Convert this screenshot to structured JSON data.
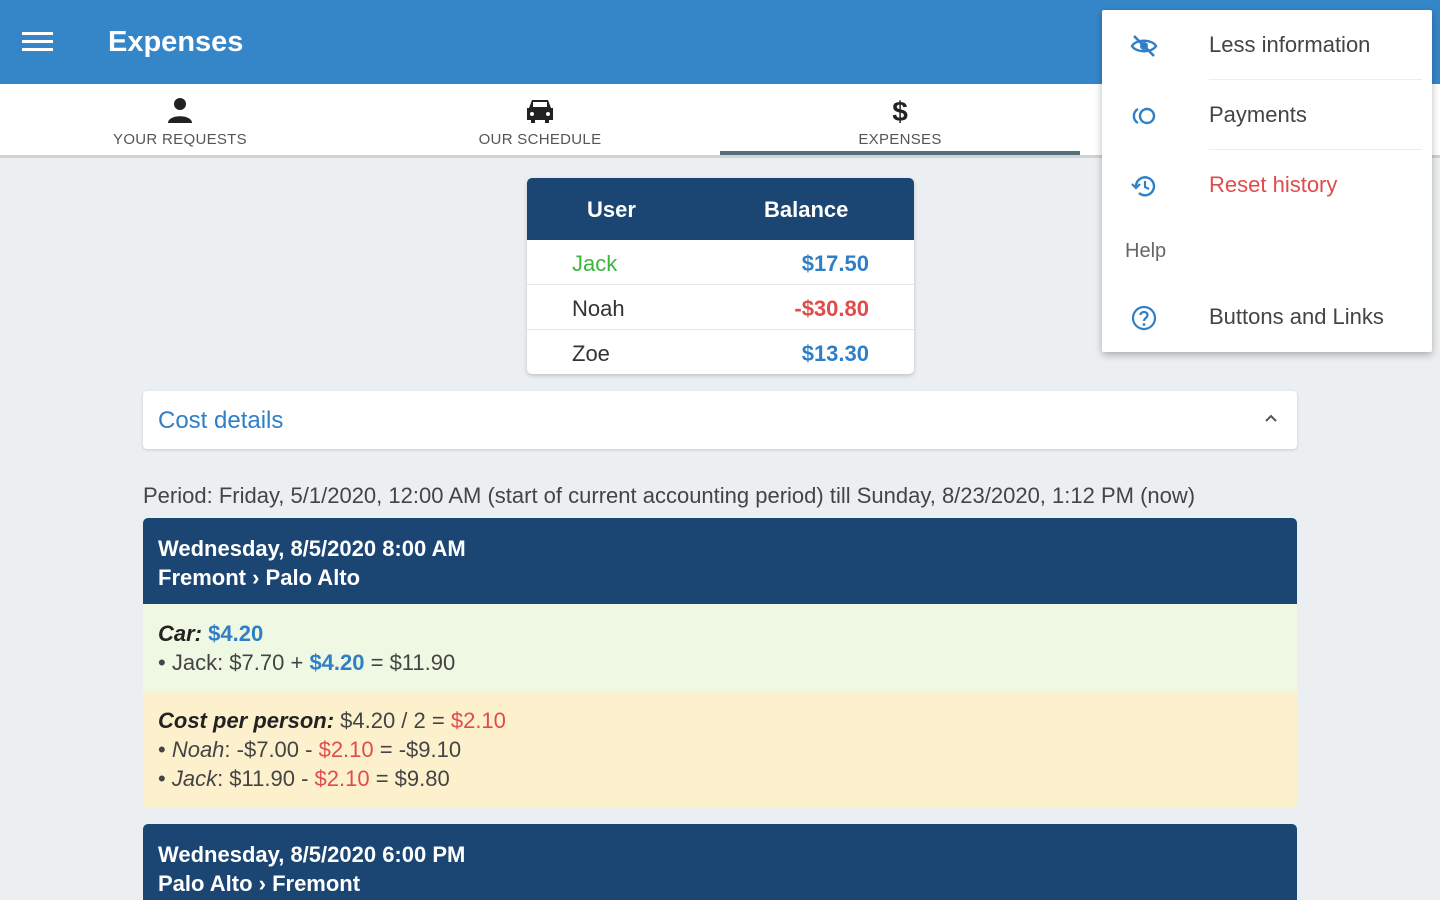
{
  "appbar": {
    "title": "Expenses"
  },
  "tabs": [
    {
      "label": "YOUR REQUESTS",
      "icon": "person-icon"
    },
    {
      "label": "OUR SCHEDULE",
      "icon": "car-icon"
    },
    {
      "label": "EXPENSES",
      "icon": "dollar-icon",
      "active": true
    },
    {
      "label": "",
      "icon": ""
    }
  ],
  "balance": {
    "headers": {
      "user": "User",
      "balance": "Balance"
    },
    "rows": [
      {
        "name": "Jack",
        "amount": "$17.50"
      },
      {
        "name": "Noah",
        "amount": "-$30.80"
      },
      {
        "name": "Zoe",
        "amount": "$13.30"
      }
    ]
  },
  "cost_details": {
    "title": "Cost details"
  },
  "period": "Period: Friday, 5/1/2020, 12:00 AM (start of current accounting period) till Sunday, 8/23/2020, 1:12 PM (now)",
  "trips": [
    {
      "date": "Wednesday, 8/5/2020 8:00 AM",
      "route": "Fremont › Palo Alto",
      "car": {
        "label": "Car:",
        "amount": "$4.20",
        "line_person": "Jack",
        "line_start": ": $7.70 + ",
        "line_amount": "$4.20",
        "line_end": " = $11.90"
      },
      "per_person": {
        "label": "Cost per person:",
        "calc": " $4.20 / 2 = ",
        "result": "$2.10",
        "lines": [
          {
            "name": "Noah",
            "start": ": -$7.00 - ",
            "amount": "$2.10",
            "end": " = -$9.10"
          },
          {
            "name": "Jack",
            "start": ": $11.90 - ",
            "amount": "$2.10",
            "end": " = $9.80"
          }
        ]
      }
    },
    {
      "date": "Wednesday, 8/5/2020 6:00 PM",
      "route": "Palo Alto › Fremont"
    }
  ],
  "menu": {
    "items": [
      {
        "label": "Less information",
        "icon": "eye-off-icon"
      },
      {
        "label": "Payments",
        "icon": "payments-icon"
      },
      {
        "label": "Reset history",
        "icon": "history-icon"
      }
    ],
    "help_header": "Help",
    "help_items": [
      {
        "label": "Buttons and Links",
        "icon": "help-circle-icon"
      }
    ]
  },
  "colors": {
    "appbar": "#3586c8",
    "table_header": "#1b4673",
    "positive": "#2f7fc7",
    "negative": "#e04b4b",
    "highlight_user": "#3bb53b",
    "car_bg": "#eef8e3",
    "per_person_bg": "#fdf1cd"
  }
}
